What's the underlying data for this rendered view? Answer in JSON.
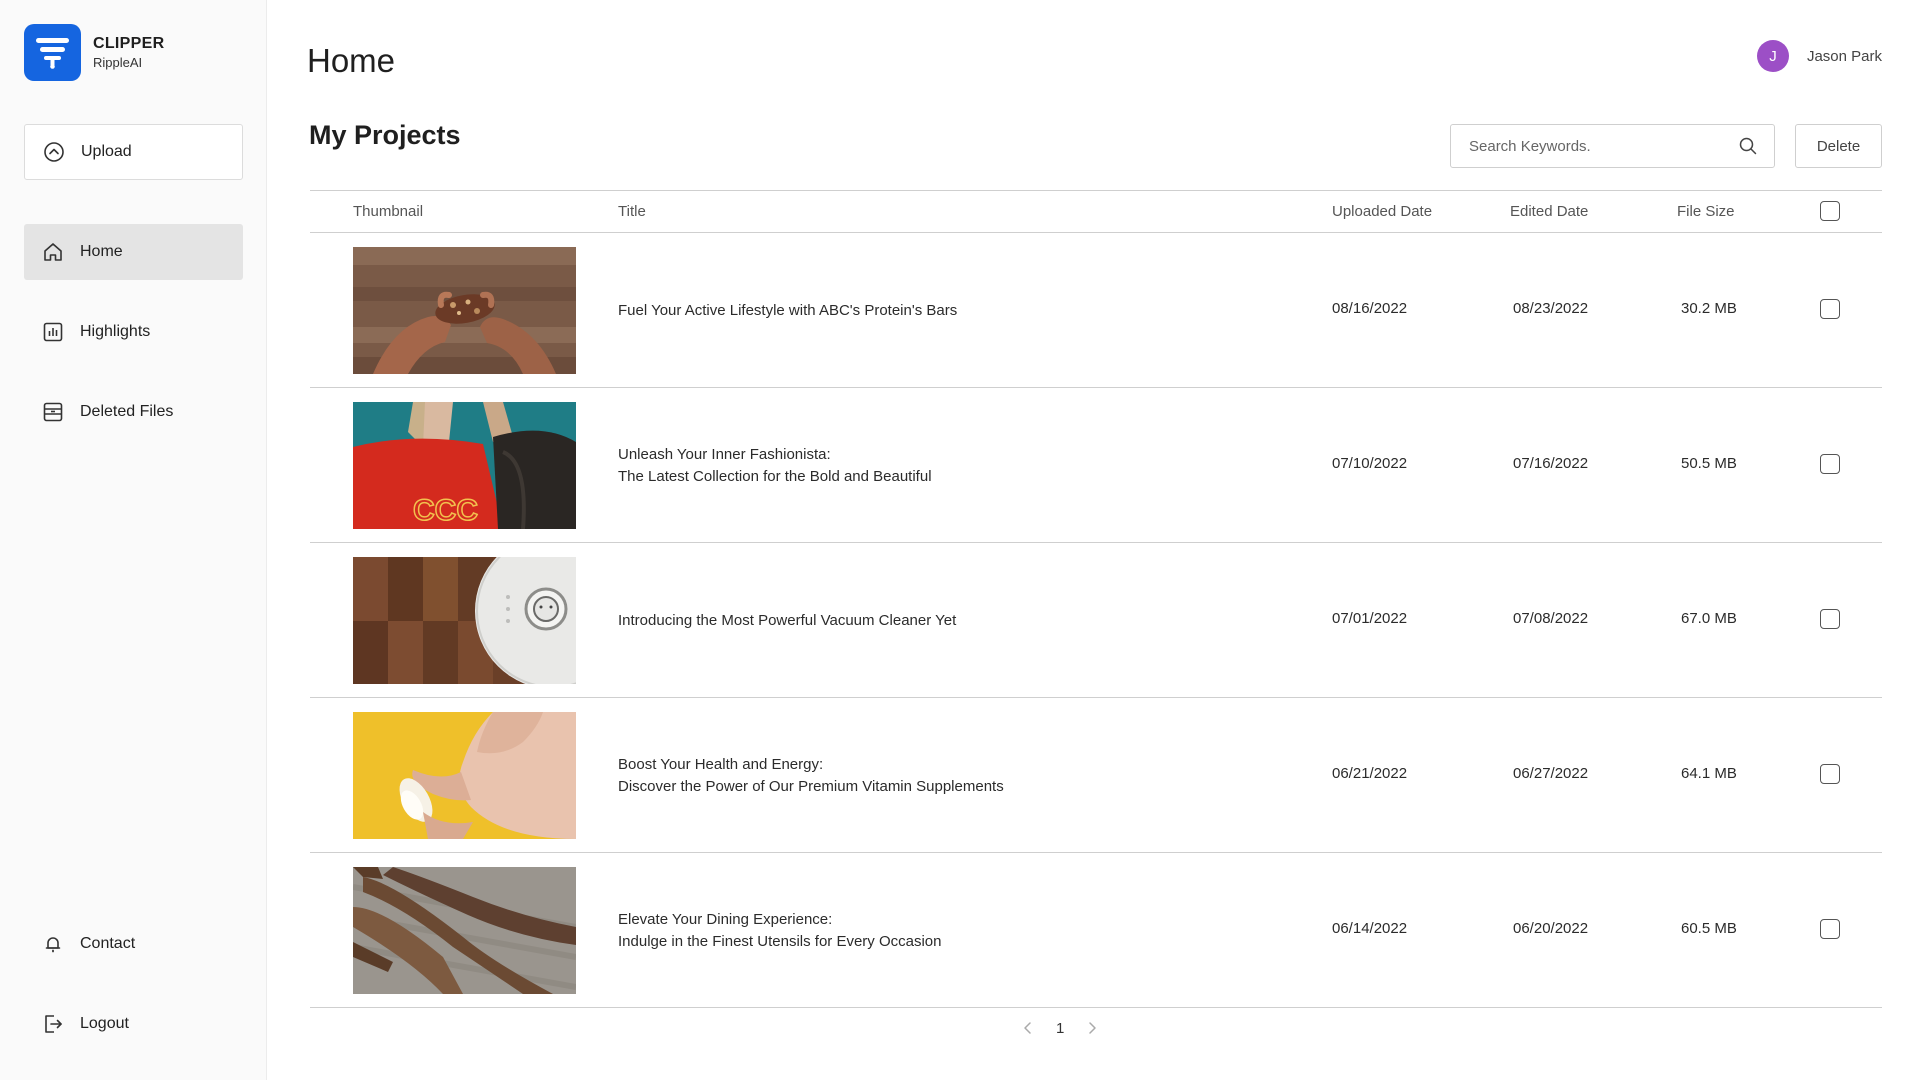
{
  "brand": {
    "name": "CLIPPER",
    "sub": "RippleAI",
    "color": "#1565e0"
  },
  "sidebar": {
    "upload": "Upload",
    "items": [
      {
        "label": "Home",
        "icon": "home-icon",
        "active": true
      },
      {
        "label": "Highlights",
        "icon": "chart-icon",
        "active": false
      },
      {
        "label": "Deleted Files",
        "icon": "trash-box-icon",
        "active": false
      }
    ],
    "bottom": [
      {
        "label": "Contact",
        "icon": "bell-icon"
      },
      {
        "label": "Logout",
        "icon": "logout-icon"
      }
    ]
  },
  "header": {
    "title": "Home",
    "user": {
      "initial": "J",
      "name": "Jason Park",
      "avatar_color": "#9c4fc6"
    }
  },
  "projects": {
    "title": "My Projects",
    "search_placeholder": "Search Keywords.",
    "delete_label": "Delete",
    "columns": {
      "thumbnail": "Thumbnail",
      "title": "Title",
      "uploaded": "Uploaded Date",
      "edited": "Edited Date",
      "size": "File Size"
    },
    "rows": [
      {
        "title_line1": "Fuel Your Active Lifestyle with ABC's Protein's Bars",
        "title_line2": "",
        "uploaded": "08/16/2022",
        "edited": "08/23/2022",
        "size": "30.2 MB",
        "thumb": "protein-bar-photo"
      },
      {
        "title_line1": "Unleash Your Inner Fashionista:",
        "title_line2": "The Latest Collection for the Bold and Beautiful",
        "uploaded": "07/10/2022",
        "edited": "07/16/2022",
        "size": "50.5 MB",
        "thumb": "fashion-photo"
      },
      {
        "title_line1": "Introducing the Most Powerful Vacuum Cleaner Yet",
        "title_line2": "",
        "uploaded": "07/01/2022",
        "edited": "07/08/2022",
        "size": "67.0 MB",
        "thumb": "robot-vacuum-photo"
      },
      {
        "title_line1": "Boost Your Health and Energy:",
        "title_line2": "Discover the Power of Our Premium Vitamin Supplements",
        "uploaded": "06/21/2022",
        "edited": "06/27/2022",
        "size": "64.1 MB",
        "thumb": "vitamin-capsule-photo"
      },
      {
        "title_line1": "Elevate Your Dining Experience:",
        "title_line2": "Indulge in the Finest Utensils for Every Occasion",
        "uploaded": "06/14/2022",
        "edited": "06/20/2022",
        "size": "60.5 MB",
        "thumb": "wooden-utensils-photo"
      }
    ],
    "pagination": {
      "current": "1"
    }
  }
}
